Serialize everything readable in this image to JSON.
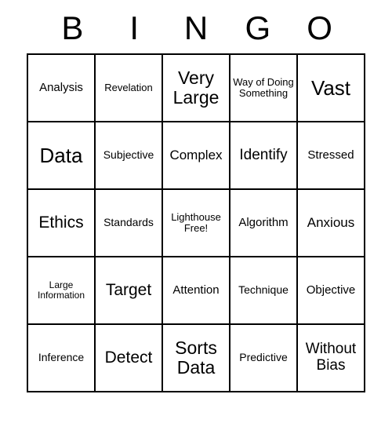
{
  "header": {
    "letters": [
      "B",
      "I",
      "N",
      "G",
      "O"
    ]
  },
  "grid": {
    "rows": [
      [
        {
          "text": "Analysis",
          "size": "fs-15"
        },
        {
          "text": "Revelation",
          "size": "fs-13"
        },
        {
          "text": "Very Large",
          "size": "fs-23"
        },
        {
          "text": "Way of Doing Something",
          "size": "fs-13"
        },
        {
          "text": "Vast",
          "size": "fs-26"
        }
      ],
      [
        {
          "text": "Data",
          "size": "fs-26"
        },
        {
          "text": "Subjective",
          "size": "fs-14"
        },
        {
          "text": "Complex",
          "size": "fs-17"
        },
        {
          "text": "Identify",
          "size": "fs-19"
        },
        {
          "text": "Stressed",
          "size": "fs-15"
        }
      ],
      [
        {
          "text": "Ethics",
          "size": "fs-21"
        },
        {
          "text": "Standards",
          "size": "fs-14"
        },
        {
          "text": "Lighthouse Free!",
          "size": "fs-13"
        },
        {
          "text": "Algorithm",
          "size": "fs-15"
        },
        {
          "text": "Anxious",
          "size": "fs-17"
        }
      ],
      [
        {
          "text": "Large Information",
          "size": "fs-12"
        },
        {
          "text": "Target",
          "size": "fs-21"
        },
        {
          "text": "Attention",
          "size": "fs-15"
        },
        {
          "text": "Technique",
          "size": "fs-14"
        },
        {
          "text": "Objective",
          "size": "fs-15"
        }
      ],
      [
        {
          "text": "Inference",
          "size": "fs-14"
        },
        {
          "text": "Detect",
          "size": "fs-21"
        },
        {
          "text": "Sorts Data",
          "size": "fs-23"
        },
        {
          "text": "Predictive",
          "size": "fs-14"
        },
        {
          "text": "Without Bias",
          "size": "fs-19"
        }
      ]
    ]
  }
}
